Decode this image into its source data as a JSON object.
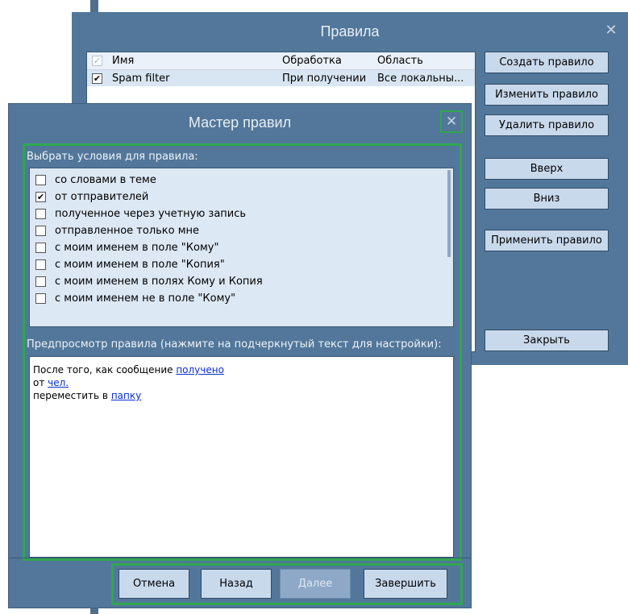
{
  "rules_window": {
    "title": "Правила",
    "close_glyph": "✕",
    "columns": {
      "name": "Имя",
      "processing": "Обработка",
      "area": "Область"
    },
    "rows": [
      {
        "checked": true,
        "name": "Spam filter",
        "processing": "При получении",
        "area": "Все локальны..."
      }
    ],
    "buttons": {
      "create": "Создать правило",
      "edit": "Изменить правило",
      "delete": "Удалить правило",
      "up": "Вверх",
      "down": "Вниз",
      "apply": "Применить правило",
      "close": "Закрыть"
    }
  },
  "wizard": {
    "title": "Мастер правил",
    "close_glyph": "✕",
    "conditions_label": "Выбрать условия для правила:",
    "conditions": [
      {
        "label": "со словами в теме",
        "checked": false
      },
      {
        "label": "от отправителей",
        "checked": true
      },
      {
        "label": "полученное через учетную запись",
        "checked": false
      },
      {
        "label": "отправленное только мне",
        "checked": false
      },
      {
        "label": "с моим именем в поле \"Кому\"",
        "checked": false
      },
      {
        "label": "с моим именем в поле \"Копия\"",
        "checked": false
      },
      {
        "label": "с моим именем в полях Кому и Копия",
        "checked": false
      },
      {
        "label": "с моим именем не в поле \"Кому\"",
        "checked": false
      }
    ],
    "preview_label": "Предпросмотр правила (нажмите на подчеркнутый текст для настройки):",
    "preview": {
      "line1_text": "После того, как сообщение ",
      "line1_link": "получено",
      "line2_text": "от ",
      "line2_link": "чел.",
      "line3_text": "переместить в ",
      "line3_link": "папку"
    },
    "buttons": {
      "cancel": "Отмена",
      "back": "Назад",
      "next": "Далее",
      "finish": "Завершить"
    }
  },
  "colors": {
    "window_bg": "#52779a",
    "button_bg": "#c9d9ec",
    "highlight_border": "#2fa84f",
    "link": "#0a2fd6"
  }
}
